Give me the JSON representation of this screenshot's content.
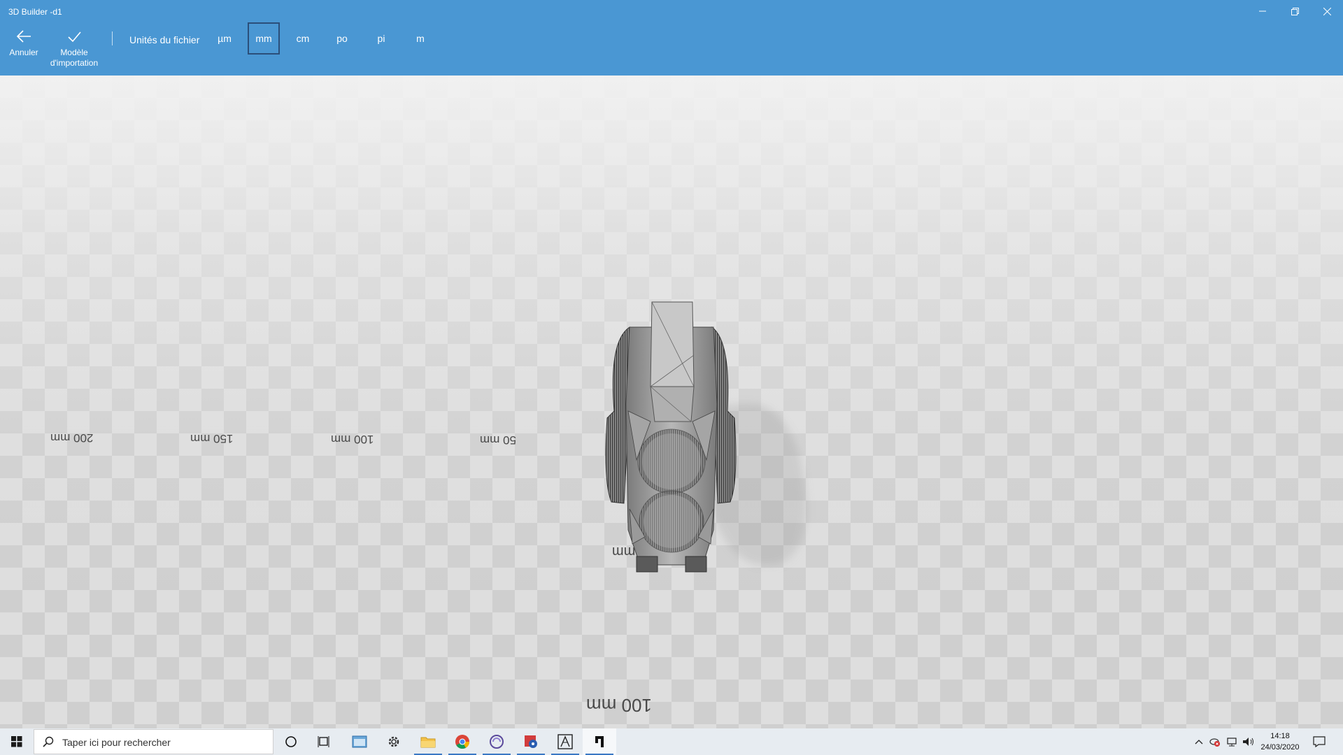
{
  "window": {
    "title": "3D Builder -d1",
    "controls": [
      "minimize-icon",
      "restore-icon",
      "close-icon"
    ]
  },
  "toolbar": {
    "cancel_label": "Annuler",
    "import_line1": "Modèle",
    "import_line2": "d'importation",
    "units_label": "Unités du fichier",
    "units": [
      "µm",
      "mm",
      "cm",
      "po",
      "pi",
      "m"
    ],
    "selected_unit": "mm",
    "accent": "#4a97d3"
  },
  "viewport": {
    "rulers_x": [
      "200 mm",
      "150 mm",
      "100 mm",
      "50 mm"
    ],
    "ruler_near": "50 mm",
    "ruler_far": "100 mm"
  },
  "taskbar": {
    "search_placeholder": "Taper ici pour rechercher",
    "apps": [
      "cortana-icon",
      "task-view-icon",
      "app-window-icon",
      "settings-gear-icon",
      "file-explorer-icon",
      "chrome-icon",
      "swirl-app-icon",
      "red-settings-app-icon",
      "drawing-app-icon",
      "3d-builder-icon"
    ],
    "tray": [
      "chevron-up-icon",
      "security-alert-icon",
      "network-icon",
      "volume-icon"
    ],
    "time": "14:18",
    "date": "24/03/2020",
    "notification_icon": "action-center-icon"
  }
}
